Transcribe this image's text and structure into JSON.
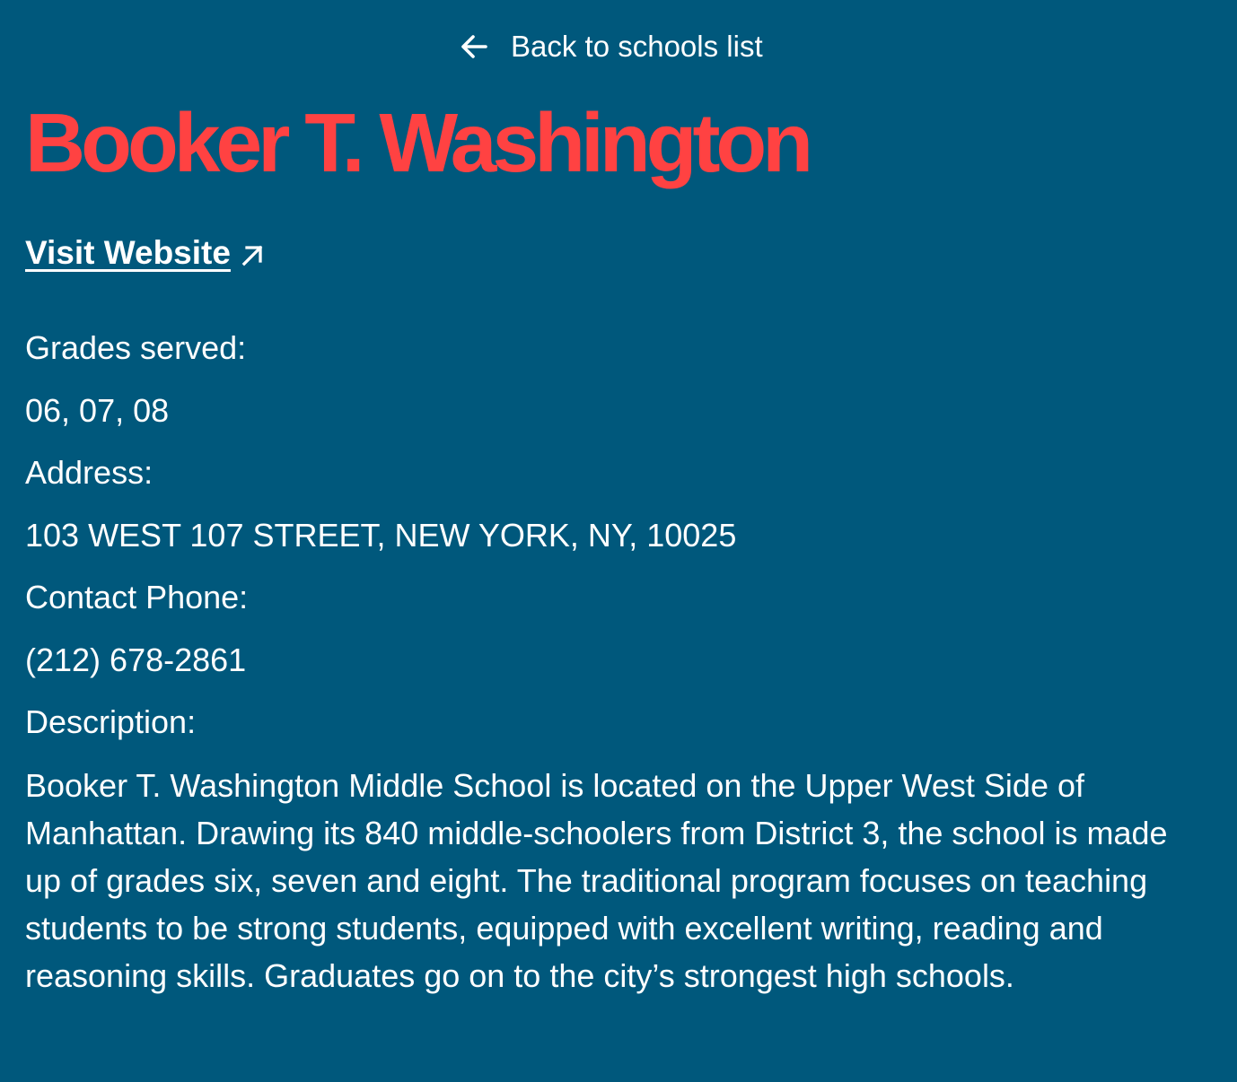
{
  "nav": {
    "back_label": "Back to schools list",
    "back_icon": "arrow-left-icon"
  },
  "school": {
    "name": "Booker T. Washington",
    "website_label": "Visit Website",
    "website_icon": "external-link-arrow-icon",
    "grades_label": "Grades served:",
    "grades_value": "06, 07, 08",
    "address_label": "Address:",
    "address_value": "103 WEST 107 STREET, NEW YORK, NY, 10025",
    "phone_label": "Contact Phone:",
    "phone_value": "(212) 678-2861",
    "description_label": "Description:",
    "description_value": "Booker T. Washington Middle School is located on the Upper West Side of Manhattan. Drawing its 840 middle-schoolers from District 3, the school is made up of grades six, seven and eight. The traditional program focuses on teaching students to be strong students, equipped with excellent writing, reading and reasoning skills. Graduates go on to the city’s strongest high schools."
  },
  "colors": {
    "background": "#00587c",
    "title": "#ff4242",
    "text": "#ffffff"
  }
}
